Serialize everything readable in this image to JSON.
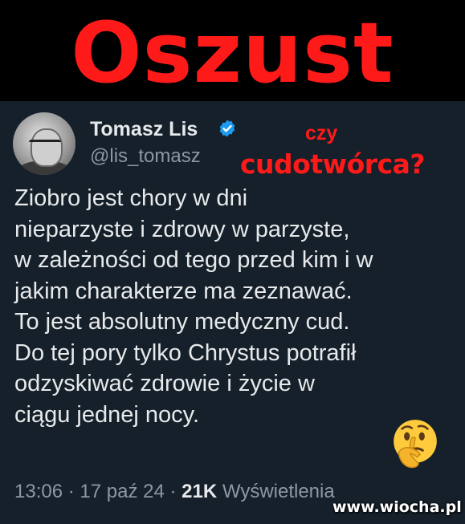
{
  "headline": "Oszust",
  "overlay": {
    "line1": "czy",
    "line2": "cudotwórca?"
  },
  "tweet": {
    "author_name": "Tomasz Lis",
    "author_handle": "@lis_tomasz",
    "verified_icon": "verified-badge-icon",
    "body_lines": [
      "Ziobro jest chory w dni",
      "nieparzyste i zdrowy w parzyste,",
      "w zależności od tego przed kim i w",
      "jakim charakterze ma zeznawać.",
      "To jest absolutny medyczny cud.",
      "Do tej pory tylko Chrystus potrafił",
      "odzyskiwać zdrowie i życie w",
      "ciągu jednej nocy."
    ],
    "emoji": "thinking-face",
    "time": "13:06",
    "date": "17 paź 24",
    "views_count": "21K",
    "views_label": "Wyświetlenia",
    "separator": "·"
  },
  "watermark": "www.wiocha.pl",
  "colors": {
    "red": "#ff1a1a",
    "card_bg": "#15202b",
    "text": "#e7e9ea",
    "muted": "#8b98a5",
    "verified": "#1d9bf0"
  }
}
